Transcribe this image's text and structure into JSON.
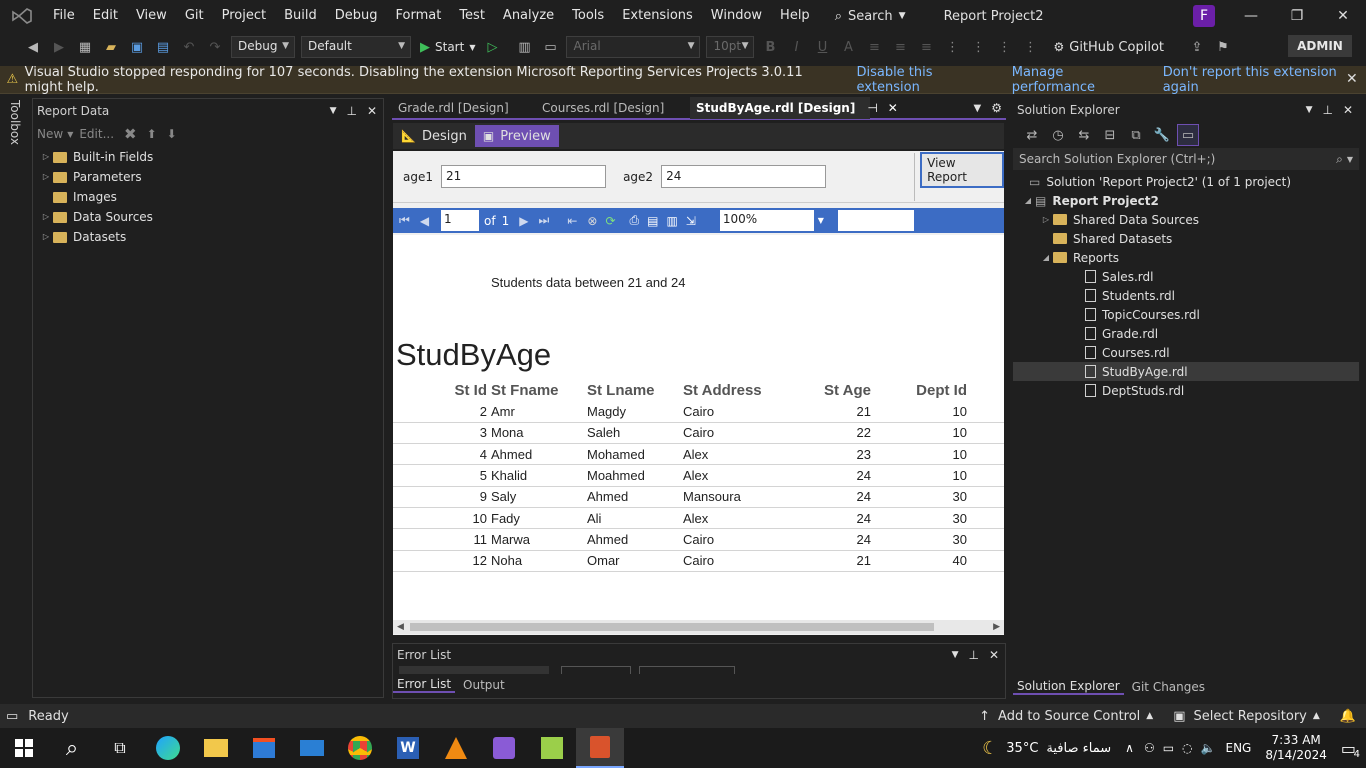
{
  "menu": {
    "items": [
      "File",
      "Edit",
      "View",
      "Git",
      "Project",
      "Build",
      "Debug",
      "Format",
      "Test",
      "Analyze",
      "Tools",
      "Extensions",
      "Window",
      "Help"
    ],
    "search": "Search",
    "title": "Report Project2",
    "avatar": "F"
  },
  "toolbar": {
    "config": "Debug",
    "platform": "Default",
    "start": "Start",
    "font": "Arial",
    "font_size": "10pt",
    "copilot": "GitHub Copilot",
    "admin": "ADMIN"
  },
  "infobar": {
    "message": "Visual Studio stopped responding for 107 seconds. Disabling the extension Microsoft Reporting Services Projects 3.0.11 might help.",
    "links": [
      "Disable this extension",
      "Manage performance",
      "Don't report this extension again"
    ]
  },
  "toolbox_label": "Toolbox",
  "report_data": {
    "title": "Report Data",
    "new": "New",
    "edit": "Edit...",
    "items": [
      "Built-in Fields",
      "Parameters",
      "Images",
      "Data Sources",
      "Datasets"
    ]
  },
  "tabs": [
    "Grade.rdl [Design]",
    "Courses.rdl [Design]",
    "StudByAge.rdl [Design]"
  ],
  "subtabs": {
    "design": "Design",
    "preview": "Preview"
  },
  "params": {
    "age1_label": "age1",
    "age1_value": "21",
    "age2_label": "age2",
    "age2_value": "24",
    "view_report": "View Report"
  },
  "viewer": {
    "page": "1",
    "of": "of",
    "total": "1",
    "zoom": "100%"
  },
  "report": {
    "subtitle": "Students data between 21 and 24",
    "title": "StudByAge",
    "columns": [
      "St Id",
      "St Fname",
      "St Lname",
      "St Address",
      "St Age",
      "Dept Id"
    ],
    "rows": [
      [
        "2",
        "Amr",
        "Magdy",
        "Cairo",
        "21",
        "10"
      ],
      [
        "3",
        "Mona",
        "Saleh",
        "Cairo",
        "22",
        "10"
      ],
      [
        "4",
        "Ahmed",
        "Mohamed",
        "Alex",
        "23",
        "10"
      ],
      [
        "5",
        "Khalid",
        "Moahmed",
        "Alex",
        "24",
        "10"
      ],
      [
        "9",
        "Saly",
        "Ahmed",
        "Mansoura",
        "24",
        "30"
      ],
      [
        "10",
        "Fady",
        "Ali",
        "Alex",
        "24",
        "30"
      ],
      [
        "11",
        "Marwa",
        "Ahmed",
        "Cairo",
        "24",
        "30"
      ],
      [
        "12",
        "Noha",
        "Omar",
        "Cairo",
        "21",
        "40"
      ]
    ]
  },
  "error_list": {
    "title": "Error List",
    "tabs": [
      "Error List",
      "Output"
    ]
  },
  "solution": {
    "title": "Solution Explorer",
    "search_placeholder": "Search Solution Explorer (Ctrl+;)",
    "solution_label": "Solution 'Report Project2' (1 of 1 project)",
    "project": "Report Project2",
    "folders": [
      "Shared Data Sources",
      "Shared Datasets",
      "Reports"
    ],
    "files": [
      "Sales.rdl",
      "Students.rdl",
      "TopicCourses.rdl",
      "Grade.rdl",
      "Courses.rdl",
      "StudByAge.rdl",
      "DeptStuds.rdl"
    ],
    "bottom_tabs": [
      "Solution Explorer",
      "Git Changes"
    ]
  },
  "status": {
    "ready": "Ready",
    "source_control": "Add to Source Control",
    "repository": "Select Repository"
  },
  "taskbar": {
    "weather": "35°C",
    "weather_text": "سماء صافية",
    "lang": "ENG",
    "time": "7:33 AM",
    "date": "8/14/2024",
    "notifications": "4"
  }
}
